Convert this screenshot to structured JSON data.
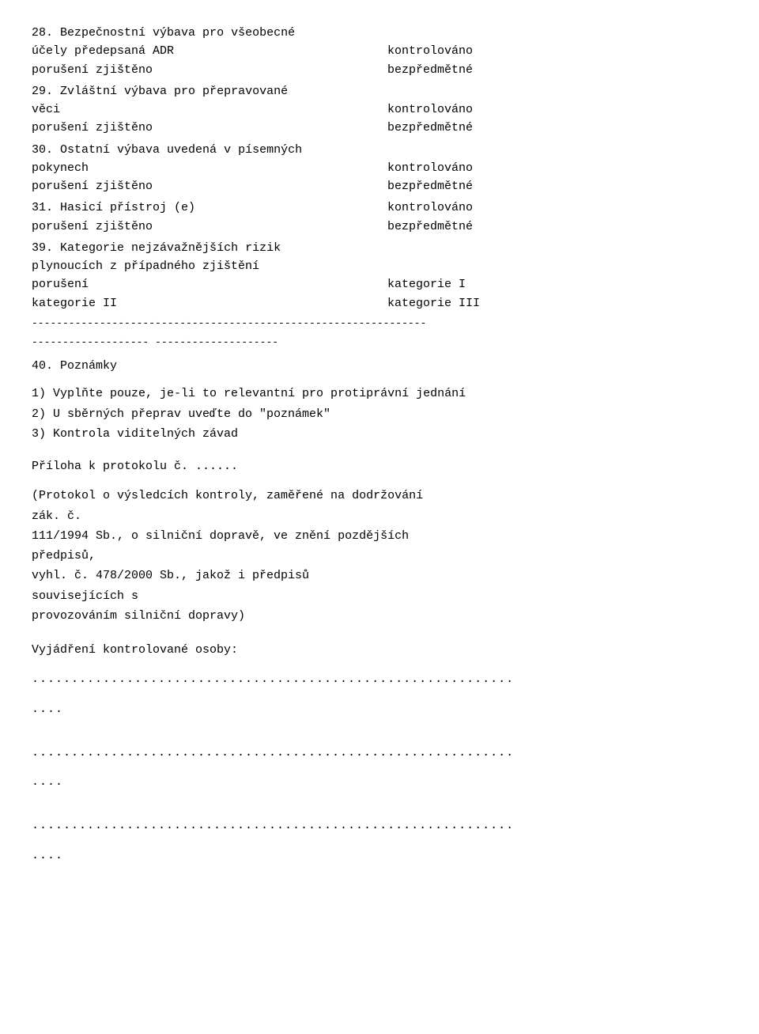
{
  "document": {
    "sections": [
      {
        "id": "s28",
        "number": "28.",
        "line1": "Bezpečnostní výbava pro všeobecné",
        "line2_left": "    účely předepsaná ADR",
        "line2_right": "kontrolováno",
        "line3_left": "porušení zjištěno",
        "line3_right_indent": "bezpředmětné"
      },
      {
        "id": "s29",
        "number": "29.",
        "line1": "Zvláštní výbava pro přepravované",
        "line2_left": "    věci",
        "line2_right": "kontrolováno",
        "line3_left": "porušení zjištěno",
        "line3_right_indent": "bezpředmětné"
      },
      {
        "id": "s30",
        "number": "30.",
        "line1": "Ostatní výbava uvedená v písemných",
        "line2_left": "    pokynech",
        "line2_right": "kontrolováno",
        "line3_left": "porušení zjištěno",
        "line3_right_indent": "bezpředmětné"
      },
      {
        "id": "s31",
        "number": "31.",
        "line1_left": "Hasicí přístroj (e)",
        "line1_right": "kontrolováno",
        "line2_left": "porušení zjištěno",
        "line2_right_indent": "bezpředmětné"
      },
      {
        "id": "s39",
        "number": "39.",
        "line1": "Kategorie nejzávažnějších rizik",
        "line2": "    plynoucích z případného zjištění",
        "line3_left": "    porušení",
        "line3_right": "kategorie I",
        "line4_left": "kategorie II",
        "line4_mid": "kategorie III",
        "separator1": "----------------------------------------------------------------",
        "separator2": "------------------- --------------------"
      }
    ],
    "section40": {
      "number": "40.",
      "title": "Poznámky"
    },
    "notes": {
      "note1": "1) Vyplňte pouze, je-li to relevantní pro protiprávní jednání",
      "note2": "2) U sběrných přeprav uveďte do \"poznámek\"",
      "note3": "3) Kontrola viditelných závad"
    },
    "appendix": {
      "title": "Příloha k protokolu č. ......",
      "line1": "(Protokol o  výsledcích  kontroly, zaměřené na  dodržování",
      "line2": "zák. č.",
      "line3": "111/1994 Sb.,  o silniční dopravě,  ve znění pozdějších",
      "line4": "předpisů,",
      "line5": "vyhl.  č.  478/2000  Sb.,  jakož  i  předpisů",
      "line6": "souvisejících  s",
      "line7": "provozováním silniční dopravy)"
    },
    "statement": {
      "label": "Vyjádření kontrolované osoby:"
    },
    "dotted_lines": [
      ".............................................................",
      "....",
      ".............................................................",
      "....",
      ".............................................................",
      "...."
    ]
  }
}
